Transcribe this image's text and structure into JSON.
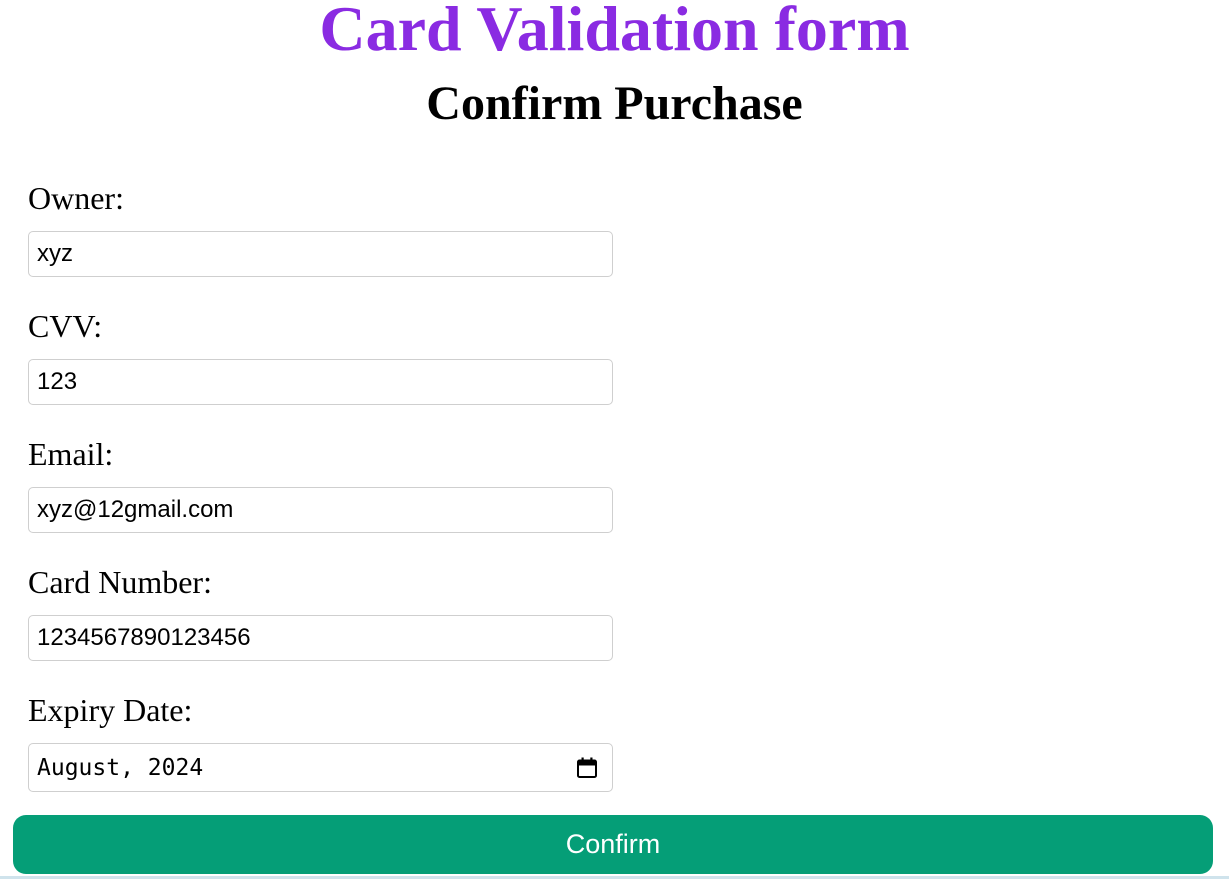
{
  "header": {
    "title": "Card Validation form",
    "subtitle": "Confirm Purchase",
    "title_color": "#8a2be2"
  },
  "form": {
    "fields": [
      {
        "label": "Owner:",
        "value": "xyz",
        "type": "text"
      },
      {
        "label": "CVV:",
        "value": "123",
        "type": "text"
      },
      {
        "label": "Email:",
        "value": "xyz@12gmail.com",
        "type": "email"
      },
      {
        "label": "Card Number:",
        "value": "1234567890123456",
        "type": "text"
      },
      {
        "label": "Expiry Date:",
        "value": "August, 2024",
        "type": "month",
        "icon": "calendar-icon"
      }
    ],
    "submit": {
      "label": "Confirm",
      "color": "#059e77"
    }
  }
}
